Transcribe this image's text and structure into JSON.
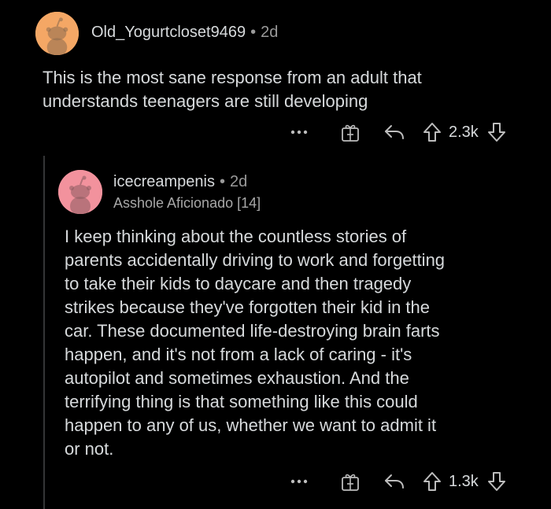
{
  "comments": [
    {
      "username": "Old_Yogurtcloset9469",
      "separator": "•",
      "age": "2d",
      "text_lines": [
        "This is the most sane response from an adult that",
        "understands teenagers are still developing"
      ],
      "actions": {
        "more": "…",
        "score": "2.3k"
      },
      "avatar_color": "#f4a765",
      "icons": [
        "more-icon",
        "award-icon",
        "reply-icon",
        "upvote-icon",
        "downvote-icon"
      ]
    },
    {
      "username": "icecreampenis",
      "separator": "•",
      "age": "2d",
      "flair": "Asshole Aficionado [14]",
      "text_lines": [
        "I keep thinking about the countless stories of",
        "parents accidentally driving to work and forgetting",
        "to take their kids to daycare and then tragedy",
        "strikes because they've forgotten their kid in the",
        "car.  These documented life-destroying brain farts",
        "happen, and it's not from a lack of caring - it's",
        "autopilot and sometimes exhaustion.  And the",
        "terrifying thing is that something like this could",
        "happen to any of us, whether we want to admit it",
        "or not."
      ],
      "actions": {
        "more": "…",
        "score": "1.3k"
      },
      "avatar_color": "#f2929d",
      "icons": [
        "more-icon",
        "award-icon",
        "reply-icon",
        "upvote-icon",
        "downvote-icon"
      ]
    }
  ],
  "colors": {
    "background": "#000000",
    "text": "#d7dadc",
    "muted": "#9a9a9a"
  }
}
